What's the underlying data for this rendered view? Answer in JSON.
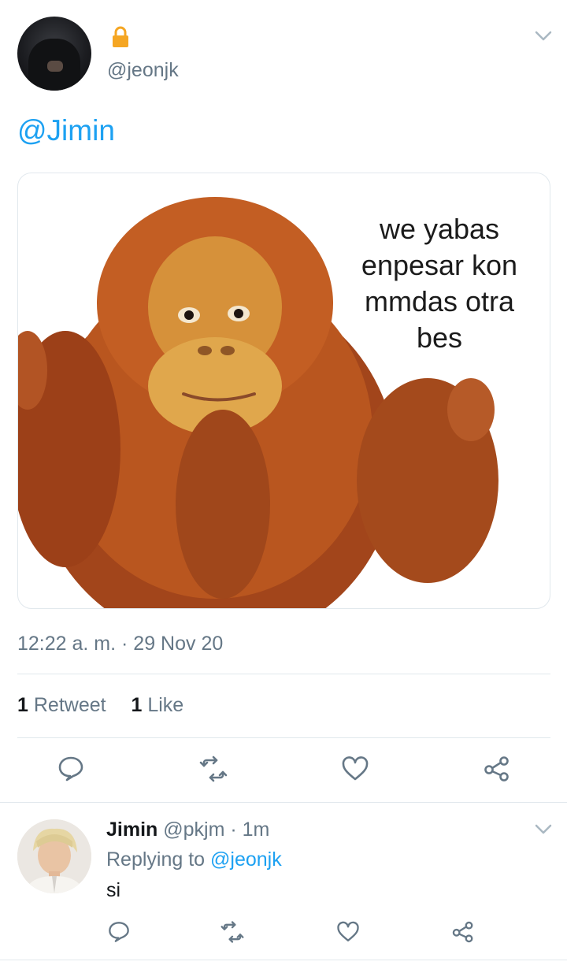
{
  "tweet": {
    "handle": "@jeonjk",
    "mention": "@Jimin",
    "image_caption": "we yabas enpesar kon mmdas otra bes",
    "timestamp": "12:22 a. m. · 29 Nov 20",
    "stats": {
      "retweet_count": "1",
      "retweet_label": "Retweet",
      "like_count": "1",
      "like_label": "Like"
    }
  },
  "reply": {
    "name": "Jimin",
    "meta": "@pkjm · 1m",
    "replying_prefix": "Replying to",
    "replying_handle": "@jeonjk",
    "text": "si"
  },
  "colors": {
    "accent": "#1da1f2",
    "muted": "#657786",
    "divider": "#e1e8ed",
    "lock": "#f5a623"
  },
  "icons": [
    "lock-icon",
    "chevron-down-icon",
    "reply-icon",
    "retweet-icon",
    "like-icon",
    "share-icon"
  ]
}
